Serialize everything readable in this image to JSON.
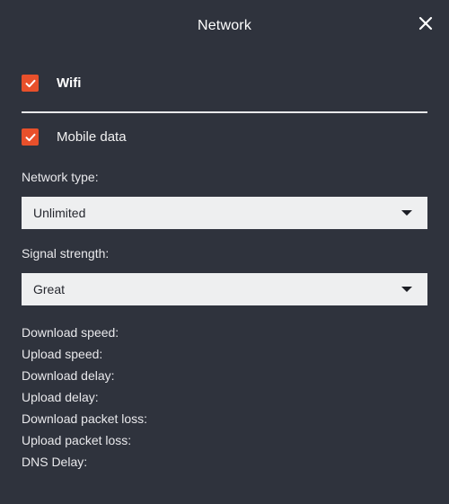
{
  "window": {
    "title": "Network",
    "close_icon": "close-icon",
    "background_color": "#2f333d",
    "accent_color": "#e8502b"
  },
  "toggles": [
    {
      "label": "Wifi",
      "checked": true,
      "bold": true
    },
    {
      "label": "Mobile data",
      "checked": true,
      "bold": false
    }
  ],
  "fields": {
    "network_type": {
      "label": "Network type:",
      "value": "Unlimited",
      "arrow_icon": "chevron-down-icon"
    },
    "signal_strength": {
      "label": "Signal strength:",
      "value": "Great",
      "arrow_icon": "chevron-down-icon"
    }
  },
  "stats": [
    {
      "label": "Download speed:",
      "value": ""
    },
    {
      "label": "Upload speed:",
      "value": ""
    },
    {
      "label": "Download delay:",
      "value": ""
    },
    {
      "label": "Upload delay:",
      "value": ""
    },
    {
      "label": "Download packet loss:",
      "value": ""
    },
    {
      "label": "Upload packet loss:",
      "value": ""
    },
    {
      "label": "DNS Delay:",
      "value": ""
    }
  ]
}
